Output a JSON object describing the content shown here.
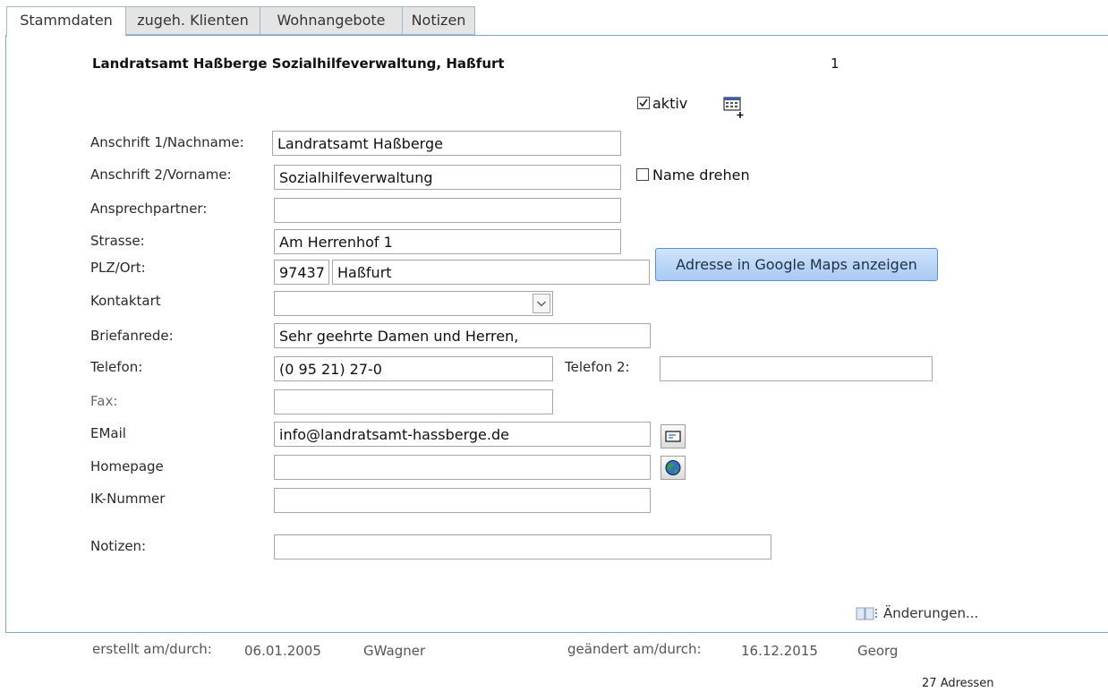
{
  "tabs": [
    "Stammdaten",
    "zugeh. Klienten",
    "Wohnangebote",
    "Notizen"
  ],
  "header": {
    "title": "Landratsamt Haßberge Sozialhilfeverwaltung, Haßfurt",
    "record_number": "1"
  },
  "aktiv": {
    "label": "aktiv",
    "checked": true
  },
  "name_drehen": {
    "label": "Name drehen",
    "checked": false
  },
  "fields": {
    "anschrift1": {
      "label": "Anschrift 1/Nachname:",
      "value": "Landratsamt Haßberge"
    },
    "anschrift2": {
      "label": "Anschrift 2/Vorname:",
      "value": "Sozialhilfeverwaltung"
    },
    "ansprechpartner": {
      "label": "Ansprechpartner:",
      "value": ""
    },
    "strasse": {
      "label": "Strasse:",
      "value": "Am Herrenhof 1"
    },
    "plzort": {
      "label": "PLZ/Ort:",
      "plz": "97437",
      "ort": "Haßfurt"
    },
    "kontaktart": {
      "label": "Kontaktart",
      "value": ""
    },
    "briefanrede": {
      "label": "Briefanrede:",
      "value": "Sehr geehrte Damen und Herren,"
    },
    "telefon": {
      "label": "Telefon:",
      "value": "(0 95 21) 27-0"
    },
    "telefon2": {
      "label": "Telefon 2:",
      "value": ""
    },
    "fax": {
      "label": "Fax:",
      "value": ""
    },
    "email": {
      "label": "EMail",
      "value": "info@landratsamt-hassberge.de"
    },
    "homepage": {
      "label": "Homepage",
      "value": ""
    },
    "ik": {
      "label": "IK-Nummer",
      "value": ""
    },
    "notizen": {
      "label": "Notizen:",
      "value": ""
    }
  },
  "buttons": {
    "google_maps": "Adresse in Google Maps anzeigen",
    "aenderungen": "Änderungen..."
  },
  "footer": {
    "created_label": "erstellt am/durch:",
    "created_date": "06.01.2005",
    "created_by": "GWagner",
    "changed_label": "geändert am/durch:",
    "changed_date": "16.12.2015",
    "changed_by": "Georg",
    "count": "27",
    "count_label": "Adressen"
  },
  "icons": [
    "address-card-add-icon",
    "email-icon",
    "globe-icon",
    "changes-list-icon",
    "chevron-down-icon",
    "checkmark-icon"
  ]
}
